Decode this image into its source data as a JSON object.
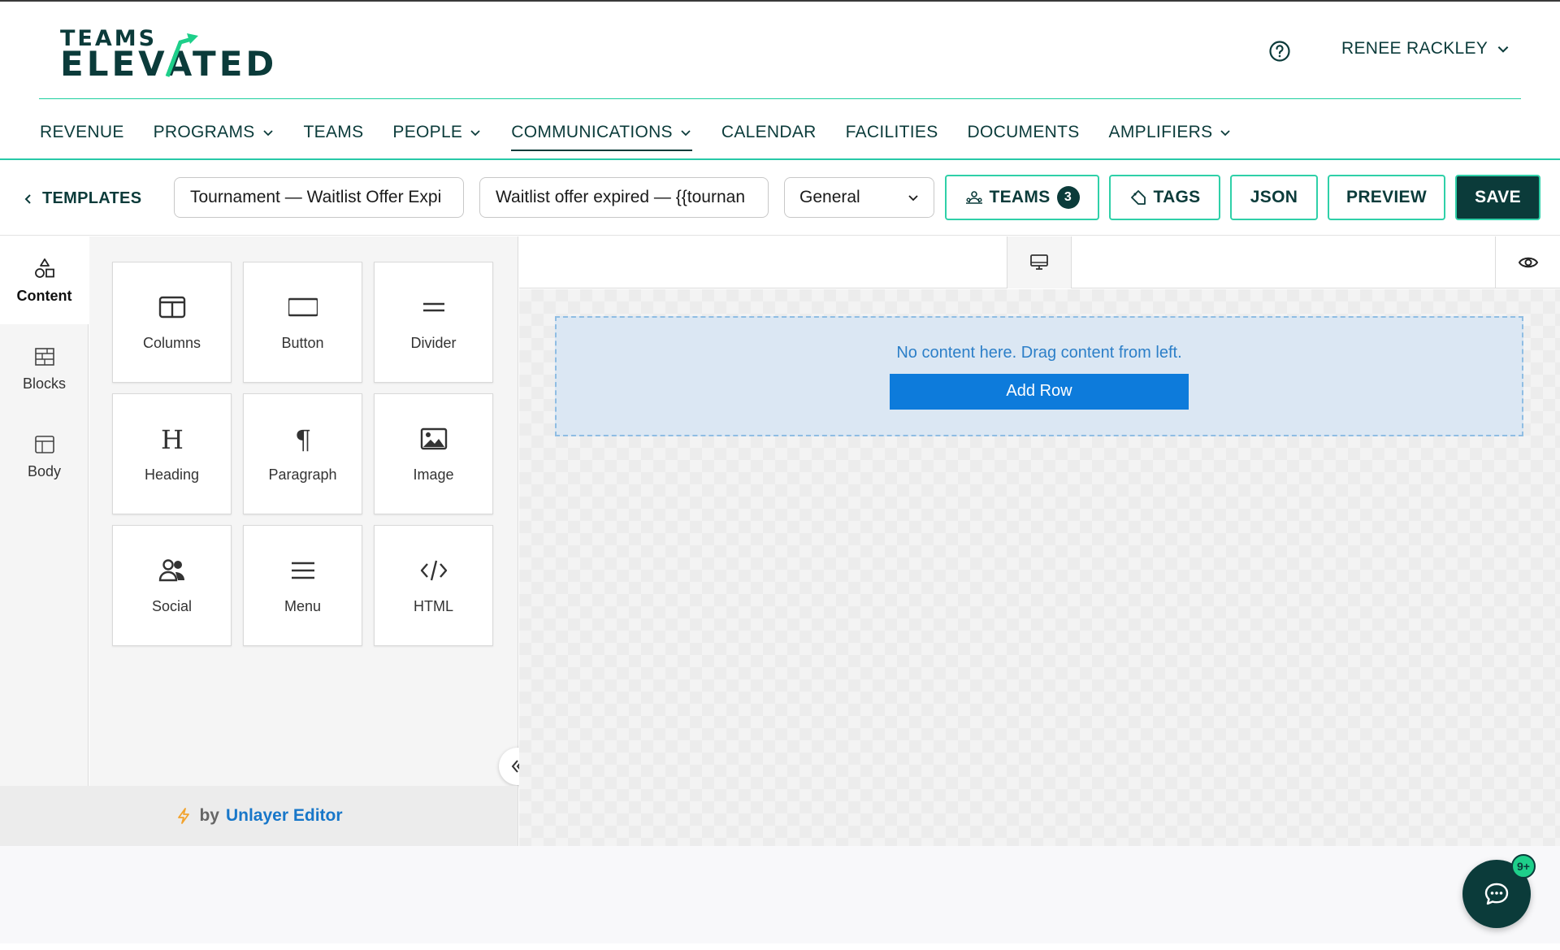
{
  "brand": {
    "line1": "TEAMS",
    "line2": "ELEVATED"
  },
  "header": {
    "user_name": "RENEE RACKLEY"
  },
  "nav": {
    "items": [
      {
        "label": "REVENUE"
      },
      {
        "label": "PROGRAMS"
      },
      {
        "label": "TEAMS"
      },
      {
        "label": "PEOPLE"
      },
      {
        "label": "COMMUNICATIONS"
      },
      {
        "label": "CALENDAR"
      },
      {
        "label": "FACILITIES"
      },
      {
        "label": "DOCUMENTS"
      },
      {
        "label": "AMPLIFIERS"
      }
    ]
  },
  "toolbar": {
    "back_label": "TEMPLATES",
    "template_name": "Tournament — Waitlist Offer Expi",
    "subject": "Waitlist offer expired — {{tournan",
    "category": "General",
    "teams_label": "TEAMS",
    "teams_count": "3",
    "tags_label": "TAGS",
    "json_label": "JSON",
    "preview_label": "PREVIEW",
    "save_label": "SAVE"
  },
  "sidetabs": [
    {
      "label": "Content"
    },
    {
      "label": "Blocks"
    },
    {
      "label": "Body"
    }
  ],
  "tools": [
    {
      "label": "Columns"
    },
    {
      "label": "Button"
    },
    {
      "label": "Divider"
    },
    {
      "label": "Heading"
    },
    {
      "label": "Paragraph"
    },
    {
      "label": "Image"
    },
    {
      "label": "Social"
    },
    {
      "label": "Menu"
    },
    {
      "label": "HTML"
    }
  ],
  "footer": {
    "by": "by",
    "brand": "Unlayer Editor"
  },
  "canvas": {
    "empty_message": "No content here. Drag content from left.",
    "add_row_label": "Add Row"
  },
  "chat": {
    "badge": "9+"
  },
  "colors": {
    "brand_dark": "#0b3b3a",
    "brand_accent": "#2fd0a8",
    "editor_blue": "#0d7bdb"
  }
}
